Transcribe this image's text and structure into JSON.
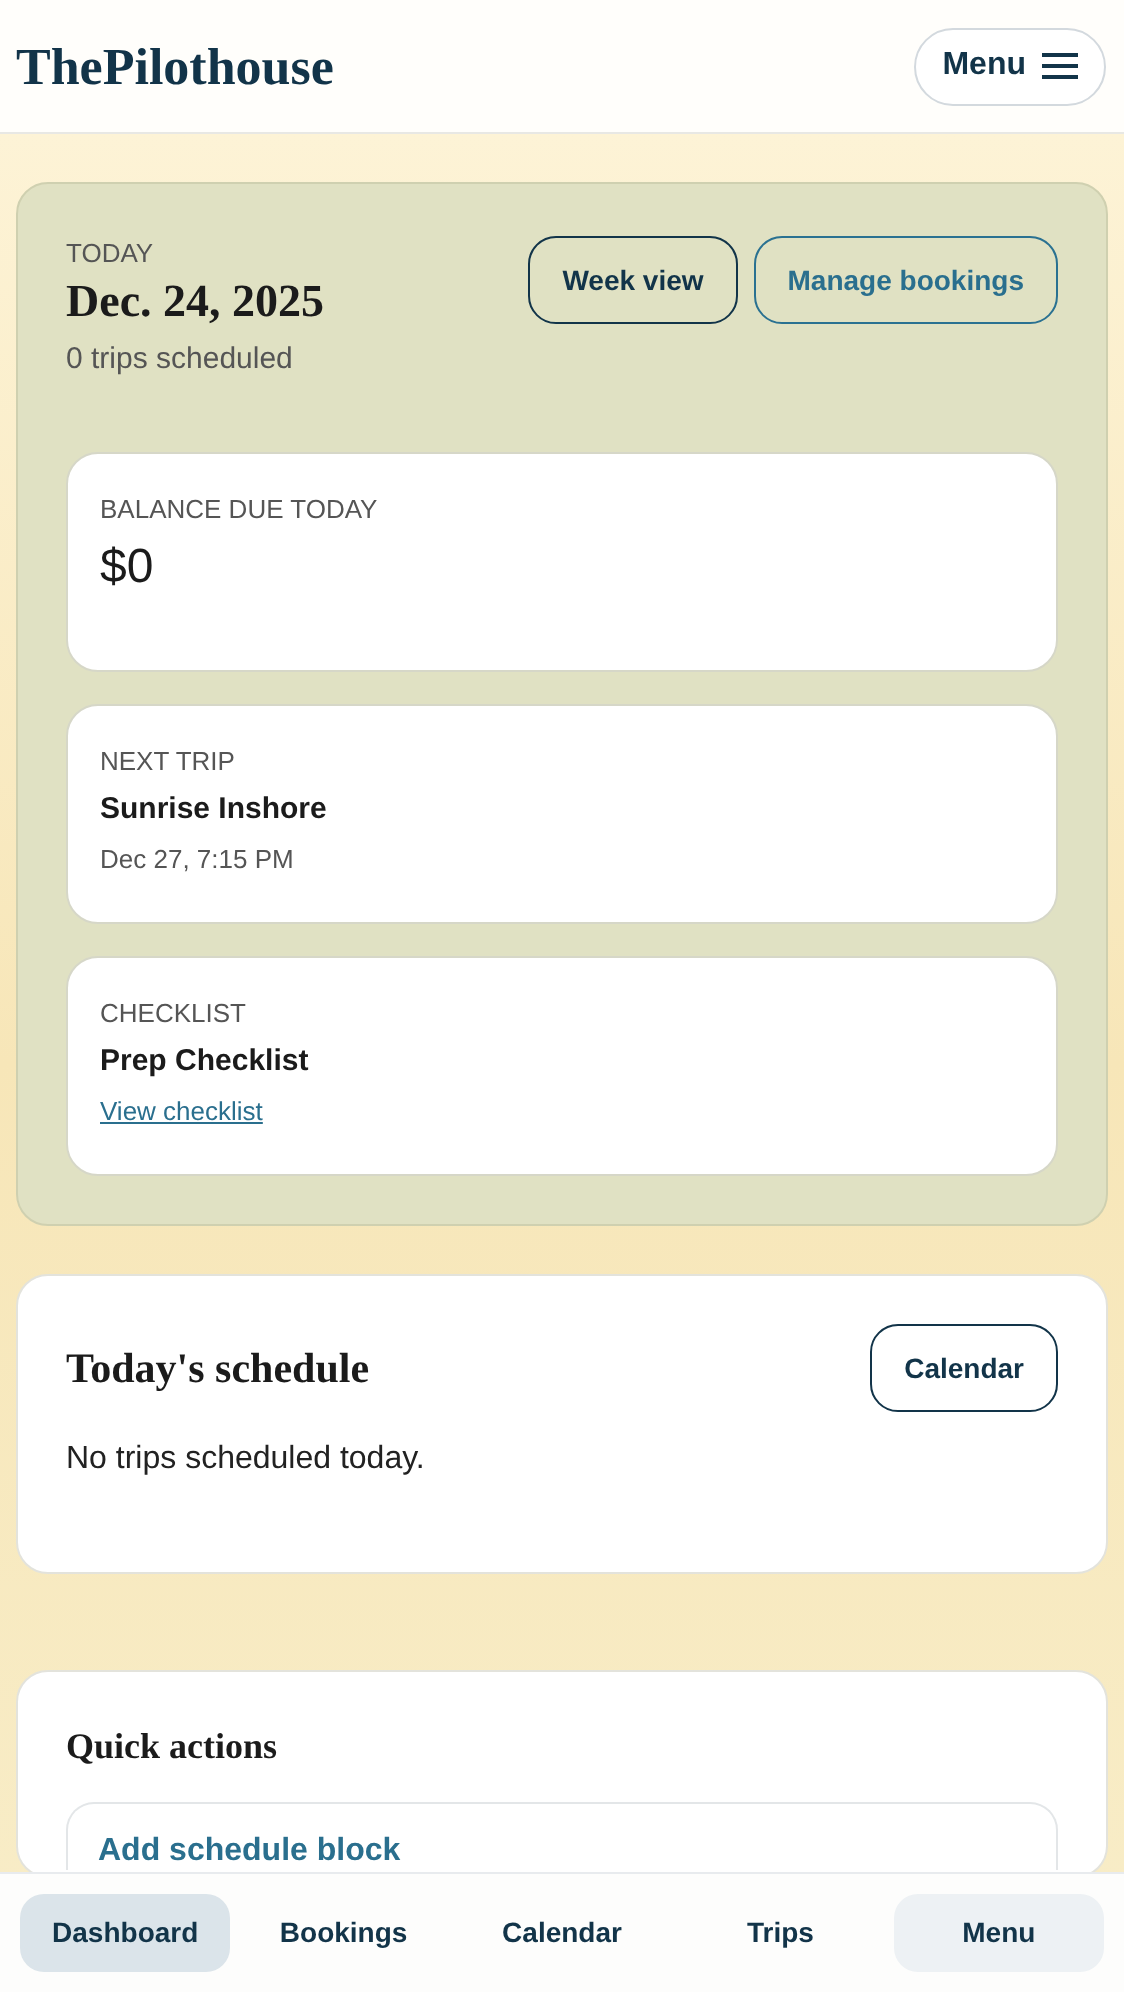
{
  "header": {
    "logo": "ThePilothouse",
    "menu_button": "Menu"
  },
  "today": {
    "label": "TODAY",
    "date": "Dec. 24, 2025",
    "summary": "0 trips scheduled",
    "buttons": [
      {
        "label": "Week view",
        "kind": "dark"
      },
      {
        "label": "Manage bookings",
        "kind": "teal"
      }
    ],
    "cards": [
      {
        "kind": "amount",
        "label": "BALANCE DUE TODAY",
        "value": "$0"
      },
      {
        "kind": "trip",
        "label": "NEXT TRIP",
        "title": "Sunrise Inshore",
        "detail": "Dec 27, 7:15 PM"
      },
      {
        "kind": "link",
        "label": "CHECKLIST",
        "title": "Prep Checklist",
        "link": "View checklist"
      }
    ]
  },
  "schedule": {
    "title": "Today's schedule",
    "button": "Calendar",
    "empty": "No trips scheduled today."
  },
  "quick_actions": {
    "title": "Quick actions",
    "items": [
      {
        "title": "Add schedule block"
      }
    ]
  },
  "bottom_nav": [
    {
      "label": "Dashboard",
      "selected": true,
      "kind": "tab"
    },
    {
      "label": "Bookings",
      "selected": false,
      "kind": "tab"
    },
    {
      "label": "Calendar",
      "selected": false,
      "kind": "tab"
    },
    {
      "label": "Trips",
      "selected": false,
      "kind": "tab"
    },
    {
      "label": "Menu",
      "selected": false,
      "kind": "menu"
    }
  ]
}
